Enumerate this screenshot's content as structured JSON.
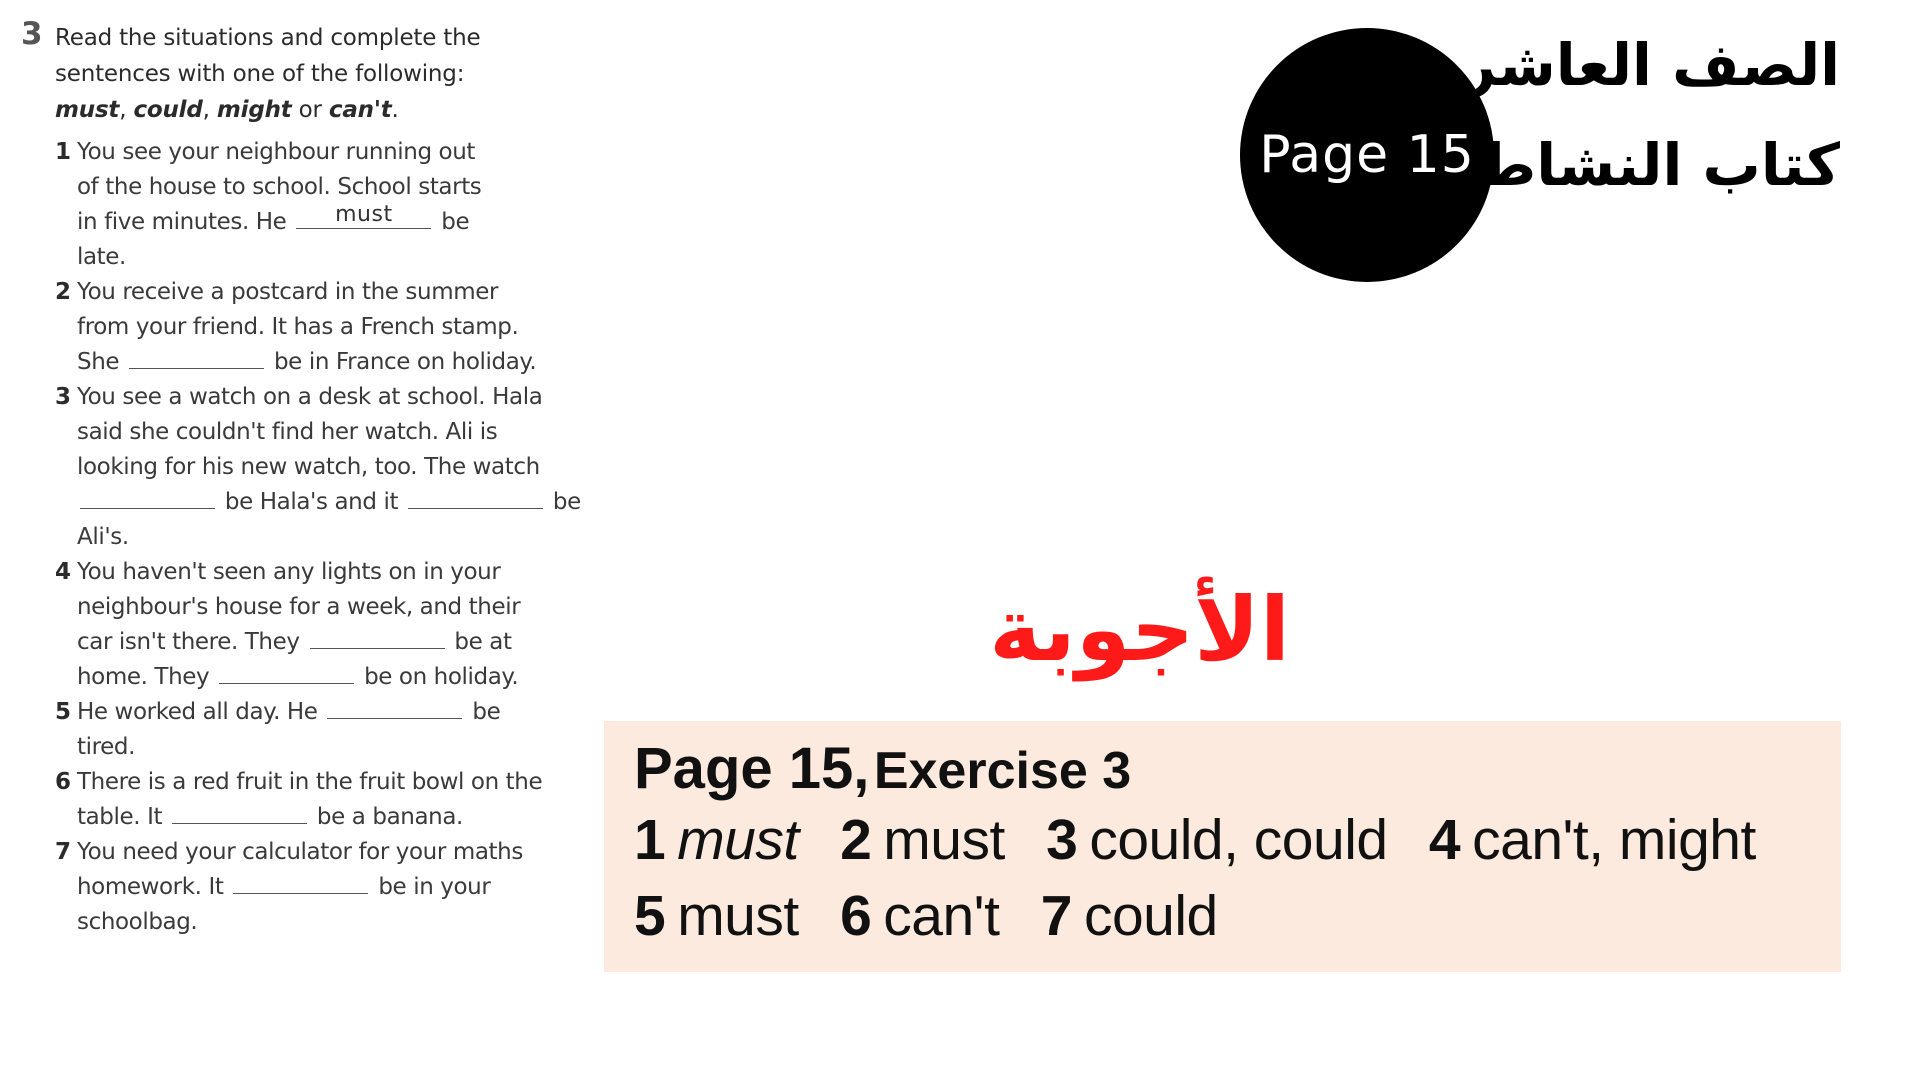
{
  "exercise": {
    "number": "3",
    "instruction_prefix": "Read the situations and complete the sentences with one of the following:",
    "modals": [
      "must",
      "could",
      "might",
      "can't"
    ],
    "connectors": [
      ", ",
      ", ",
      " or ",
      "."
    ],
    "items": [
      {
        "number": "1",
        "parts": [
          "You see your neighbour running out of the house to school. School starts in five minutes. He",
          "be late."
        ],
        "blank_answers": [
          "must"
        ]
      },
      {
        "number": "2",
        "parts": [
          "You receive a postcard in the summer from your friend. It has a French stamp. She",
          "be in France on holiday."
        ],
        "blank_answers": [
          ""
        ]
      },
      {
        "number": "3",
        "parts": [
          "You see a watch on a desk at school. Hala said she couldn't find her watch. Ali is looking for his new watch, too. The watch",
          "be Hala's and it",
          "be Ali's."
        ],
        "blank_answers": [
          "",
          ""
        ]
      },
      {
        "number": "4",
        "parts": [
          "You haven't seen any lights on in your neighbour's house for a week, and their car isn't there. They",
          "be at home. They",
          "be on holiday."
        ],
        "blank_answers": [
          "",
          ""
        ]
      },
      {
        "number": "5",
        "parts": [
          "He worked all day. He",
          "be tired."
        ],
        "blank_answers": [
          ""
        ]
      },
      {
        "number": "6",
        "parts": [
          "There is a red fruit in the fruit bowl on the table. It",
          "be a banana."
        ],
        "blank_answers": [
          ""
        ]
      },
      {
        "number": "7",
        "parts": [
          "You need your calculator for your maths homework. It",
          "be in your schoolbag."
        ],
        "blank_answers": [
          ""
        ]
      }
    ]
  },
  "badge": {
    "label": "Page 15"
  },
  "arabic": {
    "grade": "الصف العاشر",
    "book": "كتاب النشاط",
    "answers_title": "الأجوبة"
  },
  "answer_key": {
    "heading_page": "Page 15,",
    "heading_exercise": "Exercise 3",
    "rows": [
      [
        {
          "n": "1",
          "w": "must",
          "italic": true
        },
        {
          "n": "2",
          "w": "must",
          "italic": false
        },
        {
          "n": "3",
          "w": "could, could",
          "italic": false
        },
        {
          "n": "4",
          "w": "can't, might",
          "italic": false
        }
      ],
      [
        {
          "n": "5",
          "w": "must",
          "italic": false
        },
        {
          "n": "6",
          "w": "can't",
          "italic": false
        },
        {
          "n": "7",
          "w": "could",
          "italic": false
        }
      ]
    ]
  },
  "colors": {
    "answers_title": "#ff1a1a",
    "answer_box_bg": "#fdeade",
    "badge_bg": "#000000"
  }
}
